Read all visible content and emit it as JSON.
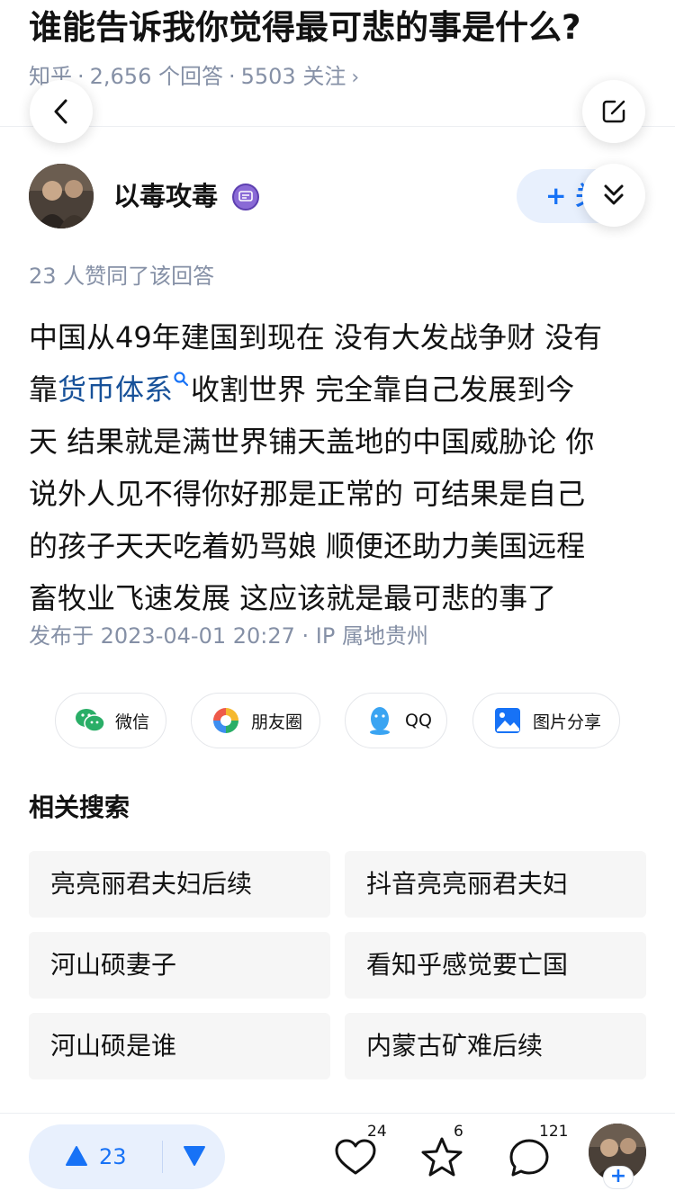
{
  "question": {
    "title": "谁能告诉我你觉得最可悲的事是什么?",
    "source": "知乎",
    "answers_count": "2,656 个回答",
    "followers": "5503 关注",
    "meta_separator": "·"
  },
  "author": {
    "name": "以毒攻毒",
    "follow_label": "+ 关"
  },
  "answer": {
    "vote_summary": "23 人赞同了该回答",
    "lines": [
      {
        "before": "中国从49年建国到现在 没有大发战争财 没有",
        "keyword": "",
        "after": ""
      },
      {
        "before": "靠",
        "keyword": "货币体系",
        "after": "收割世界 完全靠自己发展到今"
      },
      {
        "before": "天 结果就是满世界铺天盖地的中国威胁论 你",
        "keyword": "",
        "after": ""
      },
      {
        "before": "说外人见不得你好那是正常的 可结果是自己",
        "keyword": "",
        "after": ""
      },
      {
        "before": "的孩子天天吃着奶骂娘 顺便还助力美国远程",
        "keyword": "",
        "after": ""
      },
      {
        "before": "畜牧业飞速发展 这应该就是最可悲的事了",
        "keyword": "",
        "after": ""
      }
    ],
    "published": "发布于 2023-04-01 20:27 · IP 属地贵州"
  },
  "share": {
    "wechat": "微信",
    "moments": "朋友圈",
    "qq": "QQ",
    "image_share": "图片分享"
  },
  "related": {
    "title": "相关搜索",
    "items": [
      "亮亮丽君夫妇后续",
      "抖音亮亮丽君夫妇",
      "河山硕妻子",
      "看知乎感觉要亡国",
      "河山硕是谁",
      "内蒙古矿难后续"
    ]
  },
  "bottom_bar": {
    "vote_count": "23",
    "likes": "24",
    "favorites": "6",
    "comments": "121"
  },
  "colors": {
    "brand_blue": "#1772f6",
    "keyword_blue": "#175199",
    "meta_gray": "#8590a6",
    "pill_bg": "#e8f0fd",
    "chip_bg": "#f6f6f6"
  },
  "icons": [
    "back-arrow-icon",
    "edit-icon",
    "double-chevron-down-icon",
    "creator-badge-icon",
    "search-icon",
    "wechat-icon",
    "moments-icon",
    "qq-icon",
    "image-share-icon",
    "upvote-icon",
    "downvote-icon",
    "heart-icon",
    "star-icon",
    "comment-icon"
  ]
}
